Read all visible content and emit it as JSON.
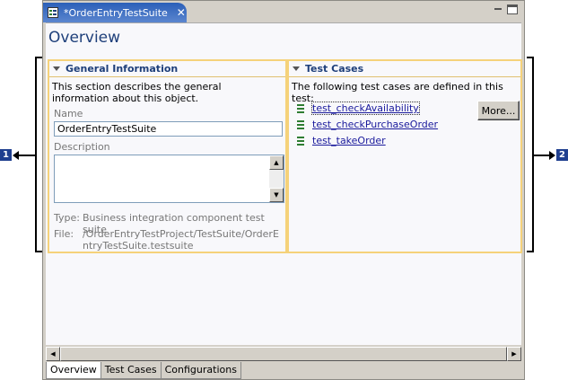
{
  "tab": {
    "title": "*OrderEntryTestSuite",
    "close_icon": "close-icon"
  },
  "page_title": "Overview",
  "general": {
    "heading": "General Information",
    "description": "This section describes the general information about this object.",
    "name_label": "Name",
    "name_value": "OrderEntryTestSuite",
    "description_label": "Description",
    "description_value": "",
    "type_label": "Type:",
    "type_value": "Business integration component test suite",
    "file_label": "File:",
    "file_value": "/OrderEntryTestProject/TestSuite/OrderEntryTestSuite.testsuite"
  },
  "test_cases": {
    "heading": "Test Cases",
    "intro": "The following test cases are defined in this test:",
    "items": [
      "test_checkAvailability",
      "test_checkPurchaseOrder",
      "test_takeOrder"
    ],
    "more_label": "More..."
  },
  "bottom_tabs": [
    "Overview",
    "Test Cases",
    "Configurations"
  ],
  "callouts": [
    "1",
    "2"
  ],
  "colors": {
    "tab_active": "#2b5fb8",
    "section_border": "#f5d27a",
    "callout": "#1f3f8f",
    "link": "#1a1a9c"
  }
}
